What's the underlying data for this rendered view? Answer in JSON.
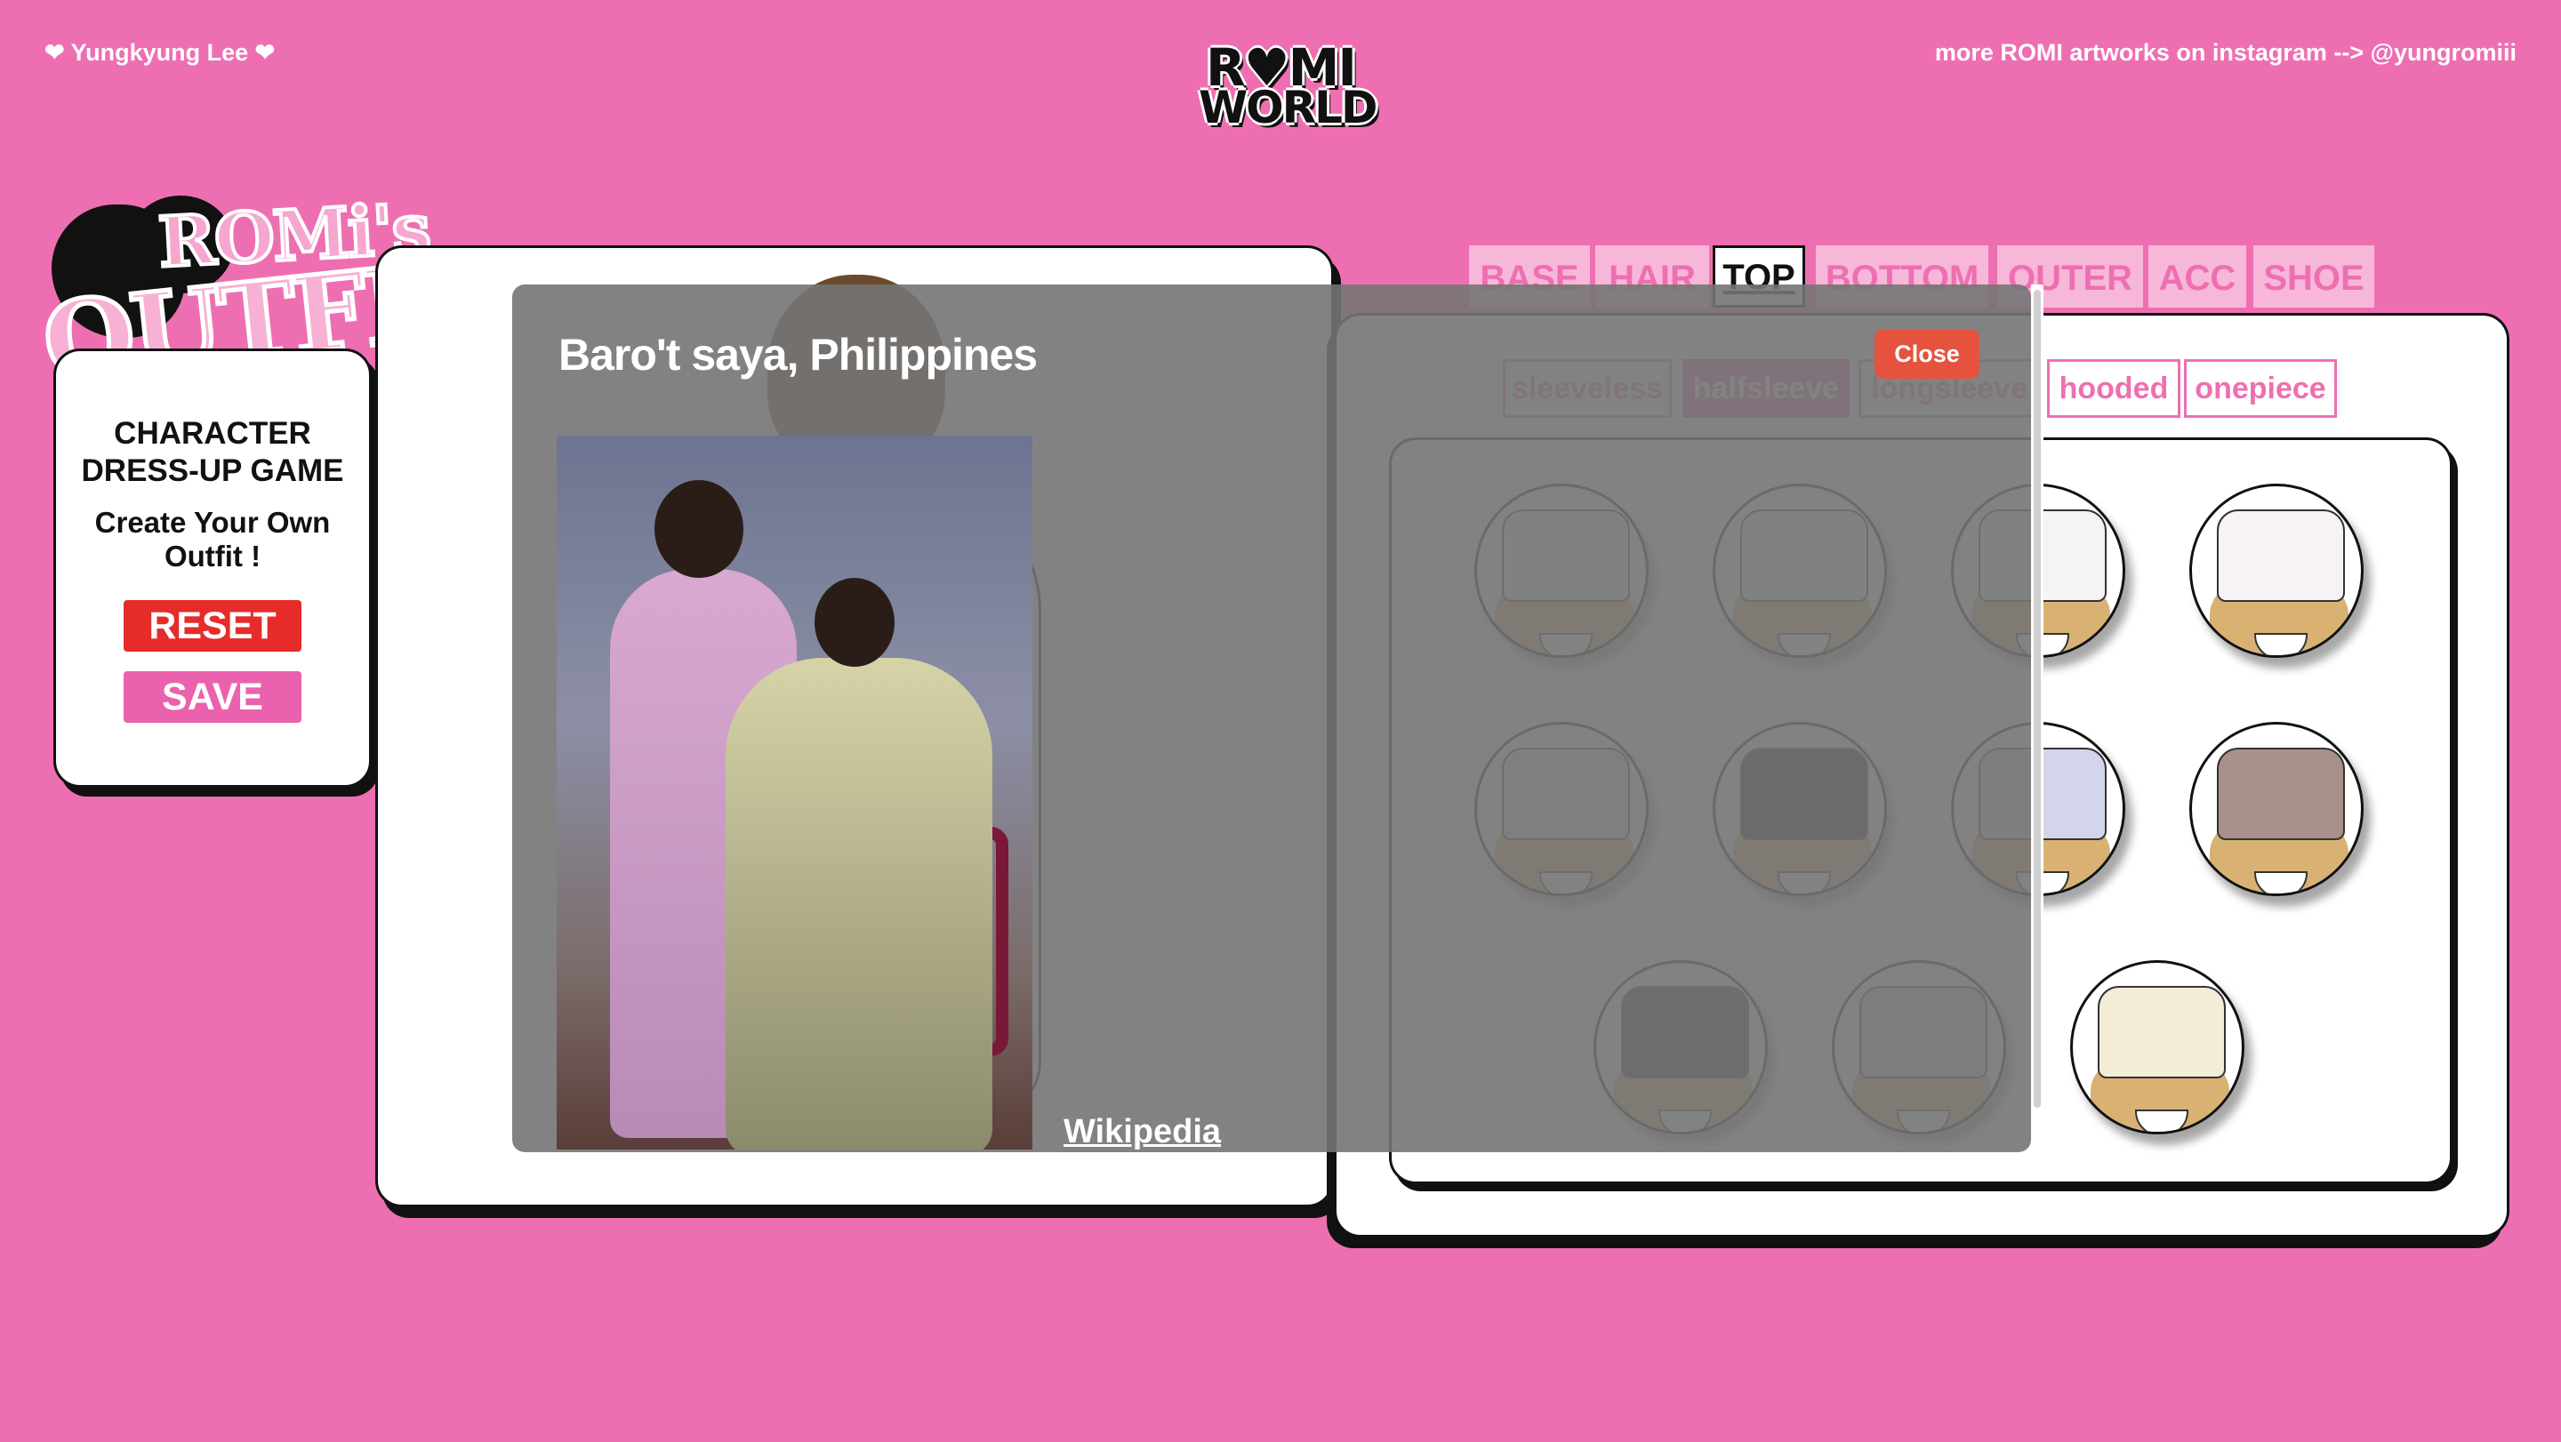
{
  "header": {
    "credit_left": "❤ Yungkyung Lee ❤",
    "credit_right": "more ROMI artworks on instagram --> @yungromiii",
    "logo_line1": "R♥MI",
    "logo_line2": "WORLD"
  },
  "game_logo": {
    "line1": "ROMi's",
    "line2": "OUTFIT"
  },
  "info_card": {
    "title": "CHARACTER DRESS-UP GAME",
    "subtitle": "Create Your Own Outfit !",
    "reset_label": "RESET",
    "save_label": "SAVE"
  },
  "tabs": [
    {
      "label": "BASE",
      "active": false
    },
    {
      "label": "HAIR",
      "active": false
    },
    {
      "label": "TOP",
      "active": true
    },
    {
      "label": "BOTTOM",
      "active": false
    },
    {
      "label": "OUTER",
      "active": false
    },
    {
      "label": "ACC",
      "active": false
    },
    {
      "label": "SHOE",
      "active": false
    }
  ],
  "subtabs": [
    {
      "label": "sleeveless",
      "active": false
    },
    {
      "label": "halfsleeve",
      "active": true
    },
    {
      "label": "longsleeve",
      "active": false
    },
    {
      "label": "hooded",
      "active": false
    },
    {
      "label": "onepiece",
      "active": false
    }
  ],
  "items": [
    {
      "name": "white crop tee",
      "color": "#f2f2f2"
    },
    {
      "name": "white tee blue cuffs",
      "color": "#eeeeee"
    },
    {
      "name": "white tee black cuffs",
      "color": "#f4f4f4"
    },
    {
      "name": "white tee romi print",
      "color": "#f7f2f6"
    },
    {
      "name": "grey wrap top",
      "color": "#d9d9d9"
    },
    {
      "name": "black heart top",
      "color": "#1d1d1d"
    },
    {
      "name": "lavender tee",
      "color": "#d3d6ea"
    },
    {
      "name": "floral brocade top",
      "color": "#a8918a"
    },
    {
      "name": "black mandarin top",
      "color": "#26282e"
    },
    {
      "name": "grey collar shirt",
      "color": "#c9c9c9"
    },
    {
      "name": "baro't saya blouse",
      "color": "#f3ecd6"
    }
  ],
  "overlay": {
    "title": "Baro't saya, Philippines",
    "link_label": "Wikipedia",
    "close_label": "Close",
    "background_color": "#747474"
  },
  "colors": {
    "page_bg": "#ee6fb1",
    "accent_pink": "#ea62ad",
    "reset_red": "#e62b2b",
    "close_red": "#e5533f",
    "tab_inactive_bg": "#f7b7d9"
  }
}
